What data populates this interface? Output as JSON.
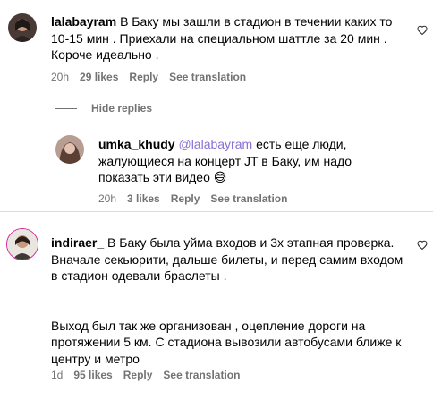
{
  "comments": [
    {
      "username": "lalabayram",
      "lines": [
        "В Баку мы зашли в стадион в течении каких то",
        "10-15 мин . Приехали на специальном шаттле за 20 мин .",
        "Короче идеально ."
      ],
      "time": "20h",
      "likes": "29 likes",
      "reply": "Reply",
      "translate": "See translation"
    },
    {
      "username": "umka_khudy",
      "mention": "@lalabayram",
      "lines": [
        "есть еще люди,",
        "жалующиеся на концерт JT в Баку, им надо",
        "показать эти видео 😅"
      ],
      "time": "20h",
      "likes": "3 likes",
      "reply": "Reply",
      "translate": "See translation"
    },
    {
      "username": "indiraer_",
      "lines": [
        "В Баку была уйма входов и 3х этапная проверка.",
        "Вначале секьюрити, дальше билеты, и перед самим входом",
        "в стадион одевали браслеты .",
        "",
        "",
        "Выход был так же организован , оцепление дороги на",
        "протяжении 5 км. С стадиона вывозили автобусами ближе к",
        "центру и метро"
      ],
      "time": "1d",
      "likes": "95 likes",
      "reply": "Reply",
      "translate": "See translation"
    }
  ],
  "hide_replies": "Hide replies"
}
